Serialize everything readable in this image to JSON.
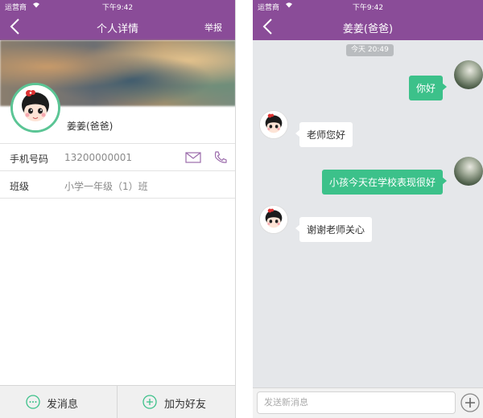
{
  "left": {
    "status": {
      "carrier": "运营商",
      "time": "下午9:42"
    },
    "nav": {
      "title": "个人详情",
      "report": "举报"
    },
    "profile": {
      "name": "姜姜(爸爸)"
    },
    "fields": [
      {
        "label": "手机号码",
        "value": "13200000001"
      },
      {
        "label": "班级",
        "value": "小学一年级（1）班"
      }
    ],
    "actions": {
      "message": "发消息",
      "add_friend": "加为好友"
    }
  },
  "right": {
    "status": {
      "carrier": "运营商",
      "time": "下午9:42"
    },
    "nav": {
      "title": "姜姜(爸爸)"
    },
    "timestamp": "今天 20:49",
    "messages": [
      {
        "from": "me",
        "text": "你好"
      },
      {
        "from": "other",
        "text": "老师您好"
      },
      {
        "from": "me",
        "text": "小孩今天在学校表现很好"
      },
      {
        "from": "other",
        "text": "谢谢老师关心"
      }
    ],
    "input": {
      "placeholder": "发送新消息"
    }
  },
  "colors": {
    "brand_purple": "#8a4c98",
    "accent_green": "#3cc18a",
    "chat_bg": "#e5e7ea"
  }
}
